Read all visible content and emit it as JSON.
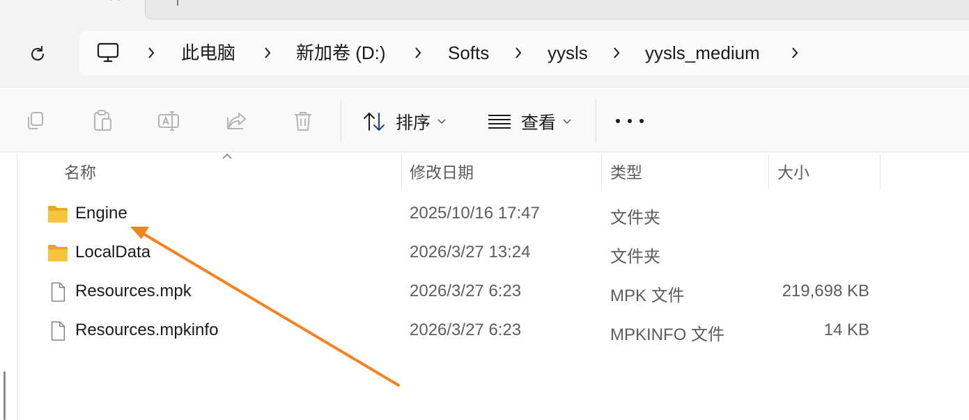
{
  "window": {
    "tab_close_icon": "close-icon",
    "new_tab_icon": "plus-icon"
  },
  "address_bar": {
    "refresh_icon": "refresh-icon",
    "root_icon": "computer-icon",
    "breadcrumbs": [
      "此电脑",
      "新加卷 (D:)",
      "Softs",
      "yysls",
      "yysls_medium"
    ]
  },
  "command_bar": {
    "copy_icon": "copy-icon",
    "paste_icon": "paste-icon",
    "rename_icon": "rename-icon",
    "share_icon": "share-icon",
    "delete_icon": "delete-icon",
    "sort_label": "排序",
    "view_label": "查看",
    "more_icon": "more-icon"
  },
  "file_list": {
    "columns": {
      "name": "名称",
      "modified": "修改日期",
      "type": "类型",
      "size": "大小"
    },
    "sorted_by": "name",
    "rows": [
      {
        "name": "Engine",
        "modified": "2025/10/16 17:47",
        "type": "文件夹",
        "size": "",
        "icon": "folder-icon"
      },
      {
        "name": "LocalData",
        "modified": "2026/3/27 13:24",
        "type": "文件夹",
        "size": "",
        "icon": "folder-icon"
      },
      {
        "name": "Resources.mpk",
        "modified": "2026/3/27 6:23",
        "type": "MPK 文件",
        "size": "219,698 KB",
        "icon": "file-icon"
      },
      {
        "name": "Resources.mpkinfo",
        "modified": "2026/3/27 6:23",
        "type": "MPKINFO 文件",
        "size": "14 KB",
        "icon": "file-icon"
      }
    ]
  },
  "annotation": {
    "color": "#f58220",
    "points_to": "Engine"
  },
  "colors": {
    "folder": "#f8c63c",
    "accent": "#f58220"
  }
}
